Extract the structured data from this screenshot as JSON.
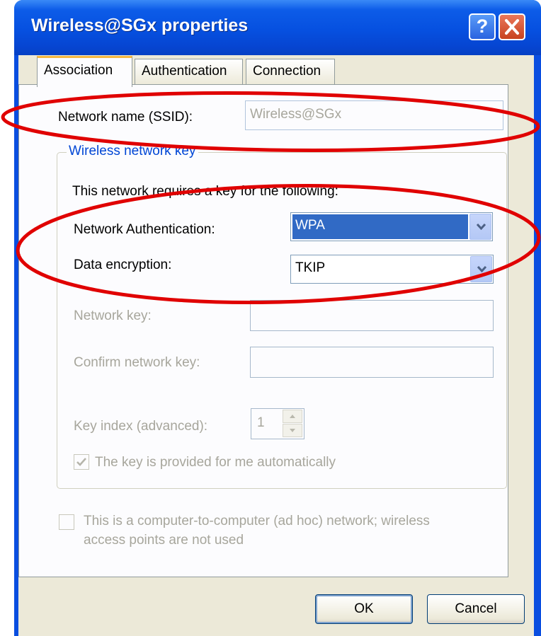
{
  "window": {
    "title": "Wireless@SGx properties",
    "help_button": "?",
    "close_button": "✕"
  },
  "tabs": [
    {
      "label": "Association",
      "active": true
    },
    {
      "label": "Authentication",
      "active": false
    },
    {
      "label": "Connection",
      "active": false
    }
  ],
  "association": {
    "ssid_label": "Network name (SSID):",
    "ssid_value": "Wireless@SGx",
    "group_title": "Wireless network key",
    "requires_text": "This network requires a key for the following:",
    "auth_label": "Network Authentication:",
    "auth_value": "WPA",
    "encryption_label": "Data encryption:",
    "encryption_value": "TKIP",
    "network_key_label": "Network key:",
    "network_key_value": "",
    "confirm_key_label": "Confirm network key:",
    "confirm_key_value": "",
    "key_index_label": "Key index (advanced):",
    "key_index_value": "1",
    "auto_key_label": "The key is provided for me automatically",
    "auto_key_checked": true,
    "adhoc_label_line1": "This is a computer-to-computer (ad hoc) network; wireless",
    "adhoc_label_line2": "access points are not used",
    "adhoc_checked": false
  },
  "buttons": {
    "ok": "OK",
    "cancel": "Cancel"
  },
  "colors": {
    "titlebar": "#0650e0",
    "dialog_face": "#ece9d8",
    "highlight": "#316ac5",
    "annotation_red": "#e00000",
    "group_title": "#0046d5"
  }
}
